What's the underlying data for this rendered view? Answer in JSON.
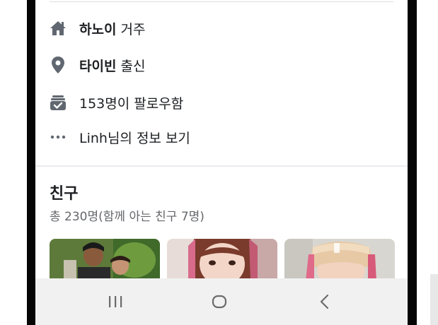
{
  "profile_info": {
    "lives_in": {
      "bold": "하노이",
      "rest": " 거주",
      "icon": "home-icon"
    },
    "from": {
      "bold": "타이빈",
      "rest": " 출신",
      "icon": "location-pin-icon"
    },
    "followers": {
      "text": "153명이 팔로우함",
      "icon": "followers-icon"
    },
    "see_info": {
      "text": "Linh님의 정보 보기",
      "icon": "more-dots-icon"
    }
  },
  "friends": {
    "title": "친구",
    "subtitle": "총 230명(함께 아는 친구 7명)",
    "photos": [
      {
        "name": "friend-photo-1"
      },
      {
        "name": "friend-photo-2"
      },
      {
        "name": "friend-photo-3"
      }
    ]
  },
  "nav_bar": {
    "buttons": [
      "recent-apps-icon",
      "home-button-icon",
      "back-icon"
    ]
  },
  "colors": {
    "text_primary": "#1c1e21",
    "text_secondary": "#65676b",
    "icon_gray": "#606770",
    "nav_bg": "#f1f1f1"
  }
}
